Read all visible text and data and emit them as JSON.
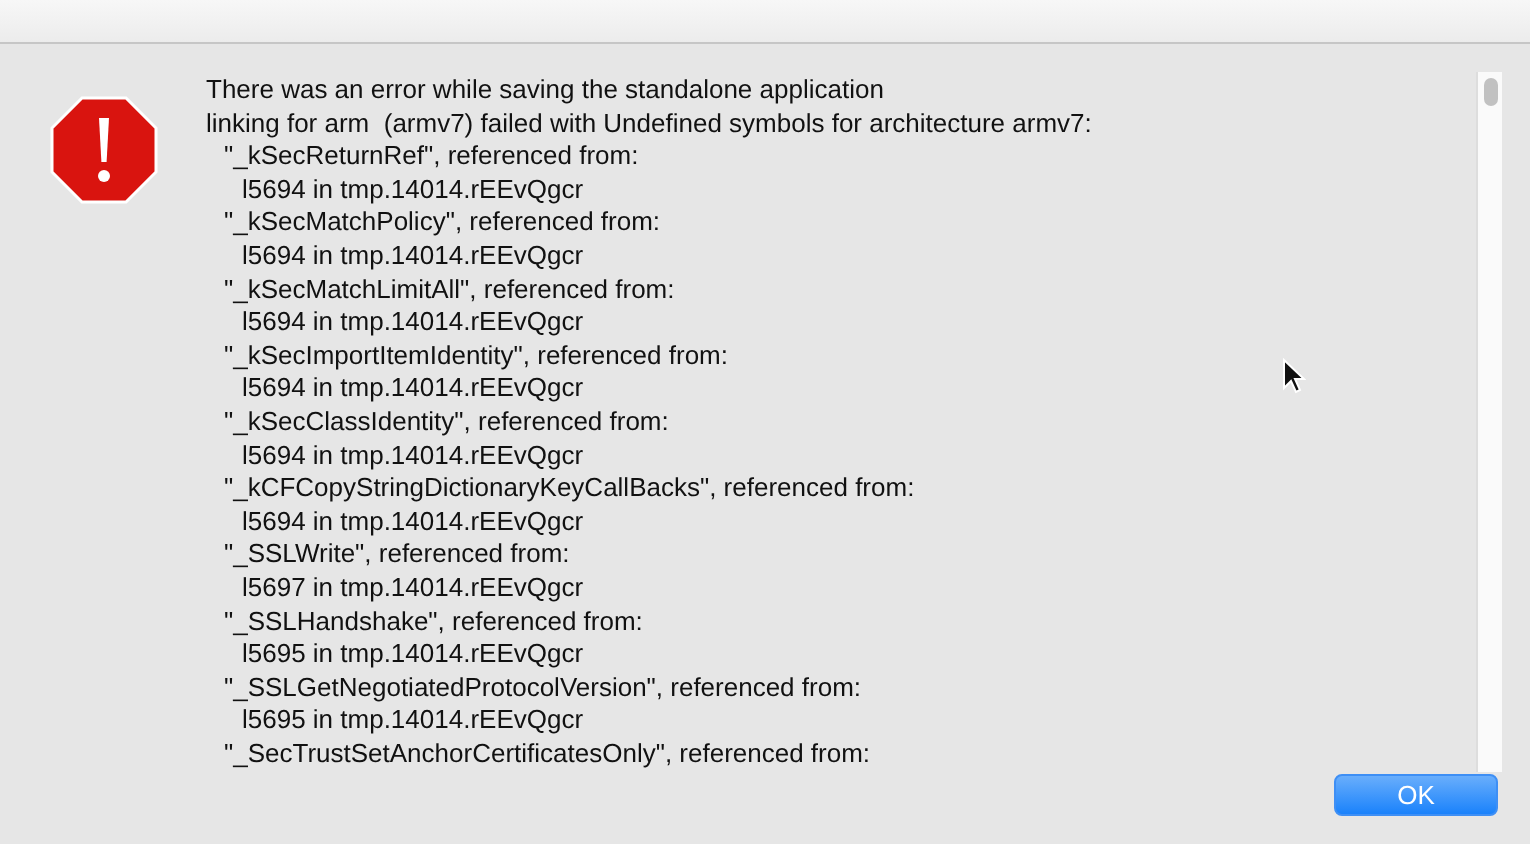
{
  "message": {
    "intro": [
      "There was an error while saving the standalone application",
      "linking for arm  (armv7) failed with Undefined symbols for architecture armv7:"
    ],
    "symbols": [
      {
        "symbol": "\"_kSecReturnRef\", referenced from:",
        "reference": "l5694 in tmp.14014.rEEvQgcr"
      },
      {
        "symbol": "\"_kSecMatchPolicy\", referenced from:",
        "reference": "l5694 in tmp.14014.rEEvQgcr"
      },
      {
        "symbol": "\"_kSecMatchLimitAll\", referenced from:",
        "reference": "l5694 in tmp.14014.rEEvQgcr"
      },
      {
        "symbol": "\"_kSecImportItemIdentity\", referenced from:",
        "reference": "l5694 in tmp.14014.rEEvQgcr"
      },
      {
        "symbol": "\"_kSecClassIdentity\", referenced from:",
        "reference": "l5694 in tmp.14014.rEEvQgcr"
      },
      {
        "symbol": "\"_kCFCopyStringDictionaryKeyCallBacks\", referenced from:",
        "reference": "l5694 in tmp.14014.rEEvQgcr"
      },
      {
        "symbol": "\"_SSLWrite\", referenced from:",
        "reference": "l5697 in tmp.14014.rEEvQgcr"
      },
      {
        "symbol": "\"_SSLHandshake\", referenced from:",
        "reference": "l5695 in tmp.14014.rEEvQgcr"
      },
      {
        "symbol": "\"_SSLGetNegotiatedProtocolVersion\", referenced from:",
        "reference": "l5695 in tmp.14014.rEEvQgcr"
      },
      {
        "symbol": "\"_SecTrustSetAnchorCertificatesOnly\", referenced from:"
      }
    ]
  },
  "buttons": [
    {
      "label": "OK",
      "kind": "default"
    }
  ]
}
